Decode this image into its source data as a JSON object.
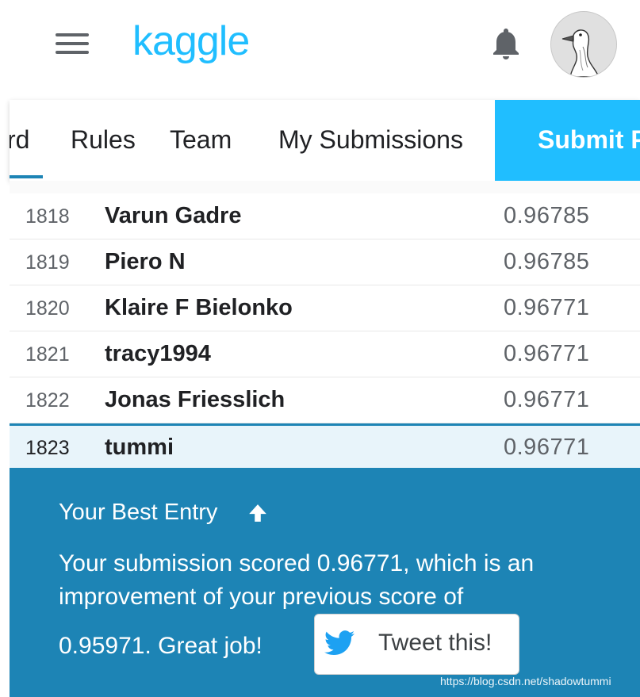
{
  "header": {
    "logo_text": "kaggle",
    "menu_icon": "hamburger-menu-icon",
    "notification_icon": "bell-icon",
    "avatar_icon": "goose-avatar"
  },
  "tabs": {
    "items": [
      {
        "label": "rd",
        "active": true
      },
      {
        "label": "Rules"
      },
      {
        "label": "Team"
      },
      {
        "label": "My Submissions"
      }
    ],
    "submit_label": "Submit P"
  },
  "leaderboard": {
    "rows": [
      {
        "rank": "1818",
        "name": "Varun Gadre",
        "score": "0.96785"
      },
      {
        "rank": "1819",
        "name": "Piero N",
        "score": "0.96785"
      },
      {
        "rank": "1820",
        "name": "Klaire F Bielonko",
        "score": "0.96771"
      },
      {
        "rank": "1821",
        "name": "tracy1994",
        "score": "0.96771"
      },
      {
        "rank": "1822",
        "name": "Jonas Friesslich",
        "score": "0.96771"
      }
    ],
    "current": {
      "rank": "1823",
      "name": "tummi",
      "score": "0.96771"
    }
  },
  "best_entry": {
    "title": "Your Best Entry",
    "arrow_icon": "arrow-up-icon",
    "line1": "Your submission scored 0.96771, which is an",
    "line2": "improvement of your previous score of",
    "line3": "0.95971. Great job!",
    "tweet_label": "Tweet this!",
    "tweet_icon": "twitter-bird-icon"
  },
  "watermark": "https://blog.csdn.net/shadowtummi",
  "colors": {
    "brand": "#20beff",
    "panel": "#1d84b5",
    "highlight_row": "#e8f4fa"
  }
}
